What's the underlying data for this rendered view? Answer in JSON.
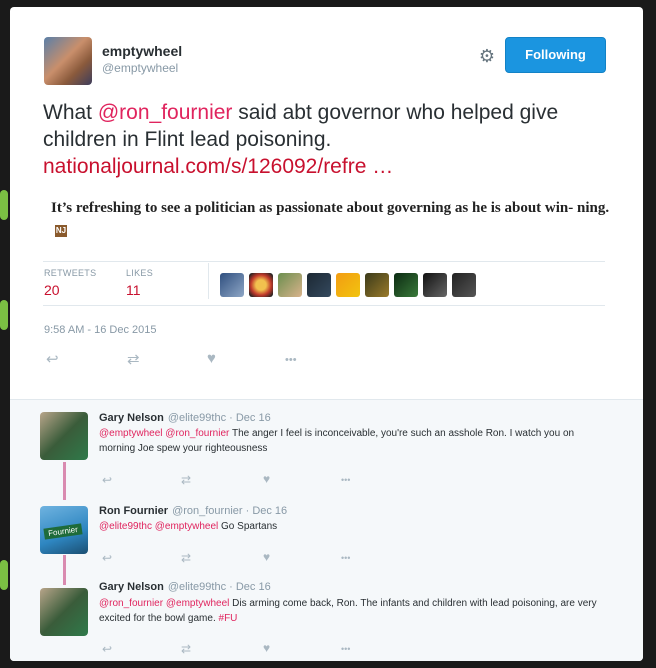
{
  "author": {
    "display_name": "emptywheel",
    "screen_name": "@emptywheel"
  },
  "follow_button": {
    "label": "Following"
  },
  "tweet": {
    "text_prefix": "What ",
    "mention": "@ron_fournier",
    "text_middle": " said abt governor who helped give children in Flint lead poisoning.",
    "link": "nationaljournal.com/s/126092/refre …",
    "card_text": "It’s refreshing to see a politician as passionate about governing as he is about win- ning.",
    "card_logo": "NJ",
    "timestamp": "9:58 AM - 16 Dec 2015"
  },
  "stats": {
    "retweets_label": "RETWEETS",
    "retweets_value": "20",
    "likes_label": "LIKES",
    "likes_value": "11"
  },
  "icons": {
    "gear": "gear-icon",
    "reply": "reply-icon",
    "retweet": "retweet-icon",
    "like": "heart-icon",
    "more": "more-icon"
  },
  "glyphs": {
    "gear": "⚙",
    "reply": "↩",
    "retweet": "⇄",
    "like": "♥",
    "more": "•••"
  },
  "replies": [
    {
      "name": "Gary Nelson",
      "handle": "@elite99thc · Dec 16",
      "mentions": "@emptywheel @ron_fournier",
      "text": " The anger I feel is inconceivable, you're such an asshole Ron. I watch you on morning Joe spew your righteousness"
    },
    {
      "name": "Ron Fournier",
      "handle": "@ron_fournier · Dec 16",
      "mentions": "@elite99thc @emptywheel",
      "text": " Go Spartans",
      "avatar_text": "Fournier"
    },
    {
      "name": "Gary Nelson",
      "handle": "@elite99thc · Dec 16",
      "mentions": "@ron_fournier @emptywheel",
      "text": " Dis arming come back, Ron. The infants and children with lead poisoning, are very excited for the bowl game. ",
      "hashtag": "#FU"
    }
  ],
  "colors": {
    "accent": "#1b95e0",
    "mention": "#e0245e",
    "link": "#c8102e",
    "thread_line": "#d98bb0"
  }
}
